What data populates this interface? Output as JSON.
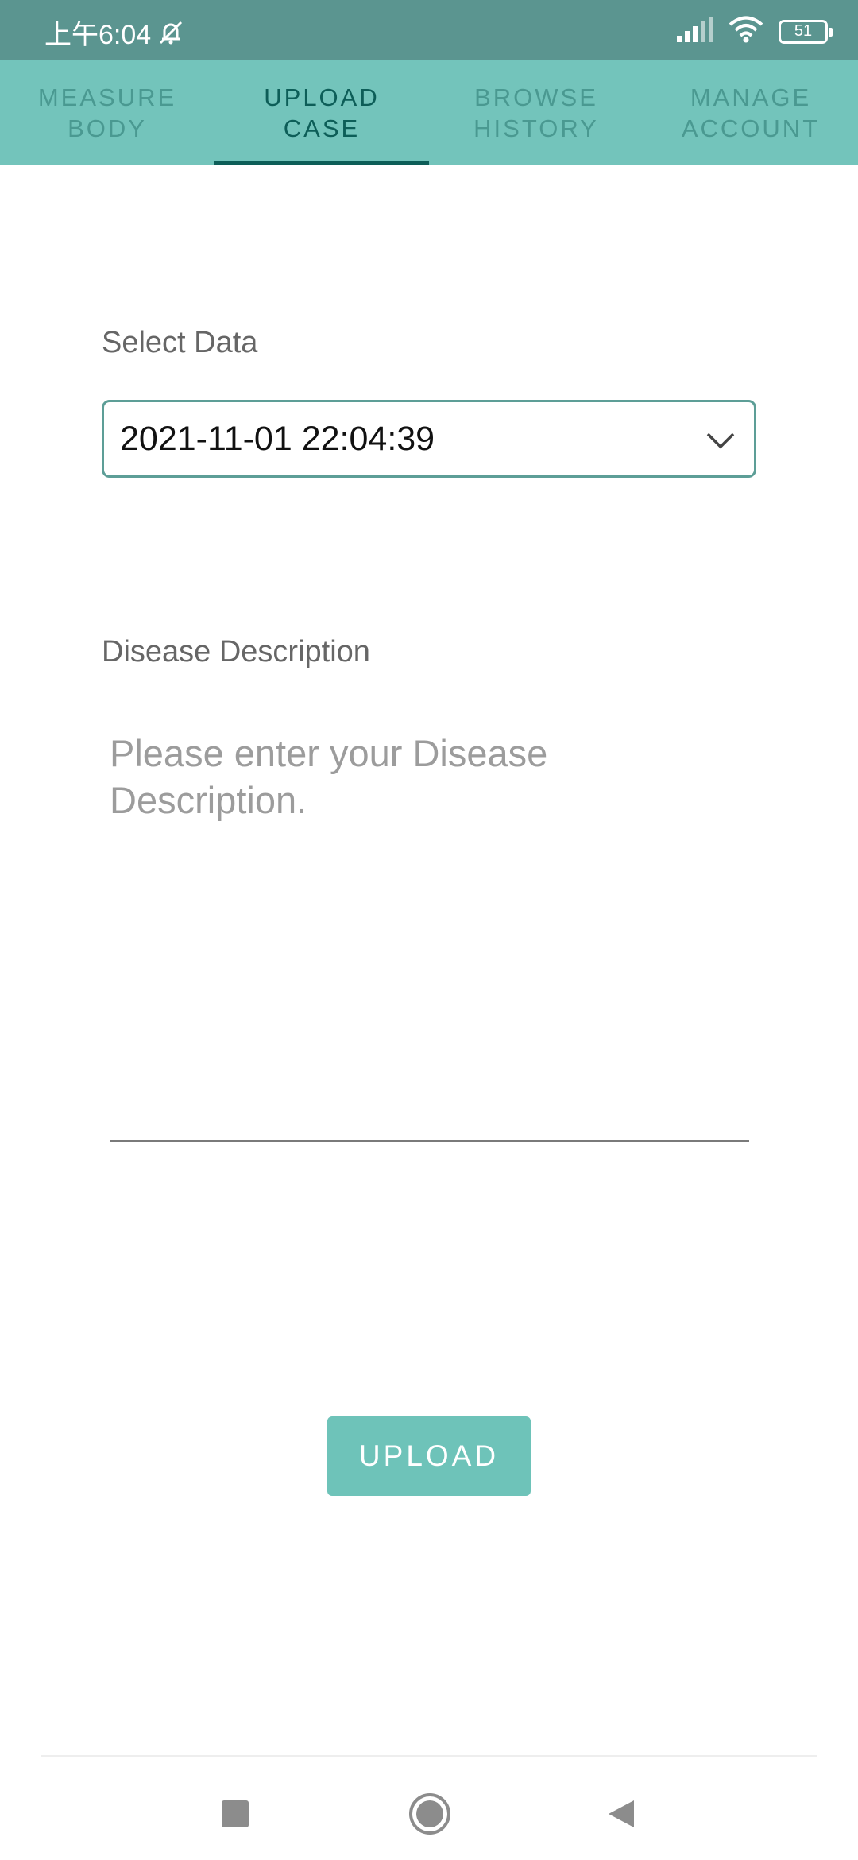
{
  "status_bar": {
    "time": "上午6:04",
    "battery": "51",
    "icons": [
      "mute-bell-icon",
      "signal-icon",
      "wifi-icon",
      "battery-icon"
    ]
  },
  "tabs": [
    {
      "label": "MEASURE\nBODY",
      "active": false
    },
    {
      "label": "UPLOAD\nCASE",
      "active": true
    },
    {
      "label": "BROWSE\nHISTORY",
      "active": false
    },
    {
      "label": "MANAGE\nACCOUNT",
      "active": false
    }
  ],
  "form": {
    "select_label": "Select Data",
    "select_value": "2021-11-01 22:04:39",
    "description_label": "Disease Description",
    "description_placeholder": "Please enter your Disease Description.",
    "description_value": ""
  },
  "upload_button": "UPLOAD",
  "nav_bar": {
    "icons": [
      "recents-icon",
      "home-icon",
      "back-icon"
    ]
  },
  "colors": {
    "status_bar": "#5b9590",
    "tab_bar": "#73c4bb",
    "tab_active": "#0d5e58",
    "tab_inactive": "#4a9991",
    "button": "#6ec3b9",
    "select_border": "#5d9e97"
  }
}
